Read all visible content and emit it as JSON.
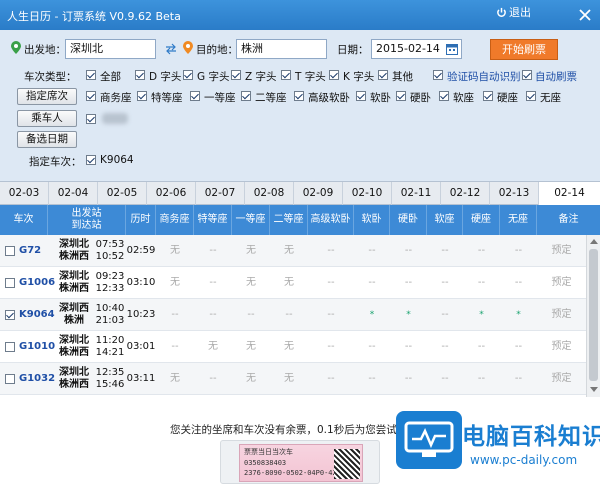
{
  "window": {
    "title": "人生日历 - 订票系统 V0.9.62 Beta",
    "logout": "退出"
  },
  "form": {
    "from_label": "出发地：",
    "from_value": "深圳北",
    "to_label": "目的地：",
    "to_value": "株洲",
    "date_label": "日期：",
    "date_value": "2015-02-14",
    "start_button": "开始刷票",
    "train_type_label": "车次类型：",
    "train_types": [
      {
        "label": "全部",
        "checked": true
      },
      {
        "label": "D 字头",
        "checked": true
      },
      {
        "label": "G 字头",
        "checked": true
      },
      {
        "label": "Z 字头",
        "checked": true
      },
      {
        "label": "T 字头",
        "checked": true
      },
      {
        "label": "K 字头",
        "checked": true
      },
      {
        "label": "其他",
        "checked": true
      }
    ],
    "captcha_auto": "验证码自动识别",
    "auto_refresh": "自动刷票",
    "seat_button": "指定席次",
    "seats": [
      {
        "label": "商务座",
        "checked": true
      },
      {
        "label": "特等座",
        "checked": true
      },
      {
        "label": "一等座",
        "checked": true
      },
      {
        "label": "二等座",
        "checked": true
      },
      {
        "label": "高级软卧",
        "checked": true
      },
      {
        "label": "软卧",
        "checked": true
      },
      {
        "label": "硬卧",
        "checked": true
      },
      {
        "label": "软座",
        "checked": true
      },
      {
        "label": "硬座",
        "checked": true
      },
      {
        "label": "无座",
        "checked": true
      }
    ],
    "passenger_button": "乘车人",
    "backup_date_button": "备选日期",
    "train_no_label": "指定车次：",
    "train_no_value": "K9064"
  },
  "dates": [
    "02-03",
    "02-04",
    "02-05",
    "02-06",
    "02-07",
    "02-08",
    "02-09",
    "02-10",
    "02-11",
    "02-12",
    "02-13",
    "02-14"
  ],
  "active_date": "02-14",
  "table": {
    "headers": {
      "train": "车次",
      "from_station": "出发站",
      "to_station": "到达站",
      "duration": "历时",
      "swz": "商务座",
      "tdz": "特等座",
      "ydz": "一等座",
      "edz": "二等座",
      "gjrw": "高级软卧",
      "rw": "软卧",
      "yw": "硬卧",
      "rz": "软座",
      "yz": "硬座",
      "wz": "无座",
      "note": "备注"
    },
    "rows": [
      {
        "train": "G72",
        "from": "深圳北",
        "to": "株洲西",
        "dep": "07:53",
        "arr": "10:52",
        "duration": "02:59",
        "checked": false,
        "seats": [
          "无",
          "--",
          "无",
          "无",
          "--",
          "--",
          "--",
          "--",
          "--",
          "--"
        ],
        "note": "预定"
      },
      {
        "train": "G1006",
        "from": "深圳北",
        "to": "株洲西",
        "dep": "09:23",
        "arr": "12:33",
        "duration": "03:10",
        "checked": false,
        "seats": [
          "无",
          "--",
          "无",
          "无",
          "--",
          "--",
          "--",
          "--",
          "--",
          "--"
        ],
        "note": "预定"
      },
      {
        "train": "K9064",
        "from": "深圳西",
        "to": "株洲",
        "dep": "10:40",
        "arr": "21:03",
        "duration": "10:23",
        "checked": true,
        "seats": [
          "--",
          "--",
          "--",
          "--",
          "--",
          "*",
          "*",
          "--",
          "*",
          "*"
        ],
        "note": "预定"
      },
      {
        "train": "G1010",
        "from": "深圳北",
        "to": "株洲西",
        "dep": "11:20",
        "arr": "14:21",
        "duration": "03:01",
        "checked": false,
        "seats": [
          "--",
          "无",
          "无",
          "无",
          "--",
          "--",
          "--",
          "--",
          "--",
          "--"
        ],
        "note": "预定"
      },
      {
        "train": "G1032",
        "from": "深圳北",
        "to": "株洲西",
        "dep": "12:35",
        "arr": "15:46",
        "duration": "03:11",
        "checked": false,
        "seats": [
          "无",
          "--",
          "无",
          "无",
          "--",
          "--",
          "--",
          "--",
          "--",
          "--"
        ],
        "note": "预定"
      }
    ]
  },
  "notice": {
    "message": "您关注的坐席和车次没有余票，0.1秒后为您尝试21次刷票！",
    "ticket_line1": "票票当日当次车",
    "ticket_line2": "0350838403",
    "ticket_line3": "2376-8090-0502-04P0-4235-3"
  },
  "watermark": {
    "brand": "电脑百科知识",
    "url": "www.pc-daily.com"
  },
  "colors": {
    "title_bar": "#2f86d3",
    "form_bg": "#dde8f4",
    "header_bg": "#3d8ad6",
    "start_button": "#f07a2a",
    "available_star": "#1aa36f",
    "train_link": "#1f4fa6"
  }
}
